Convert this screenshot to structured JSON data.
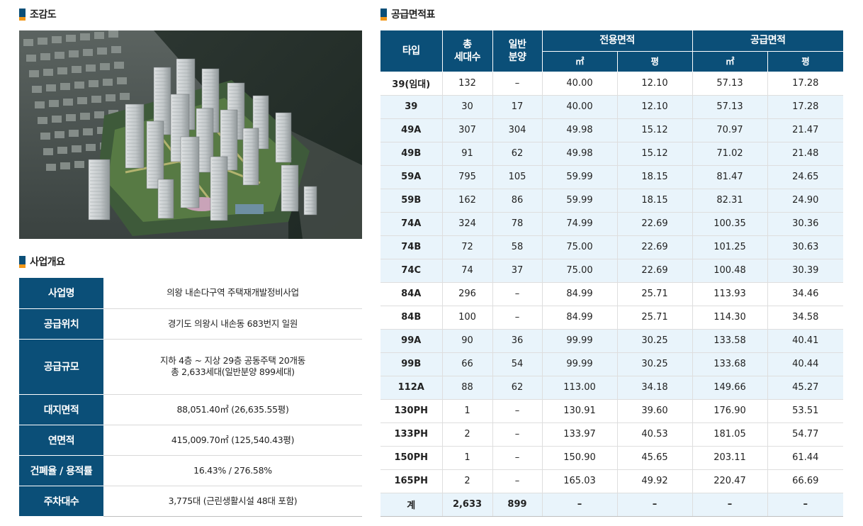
{
  "left": {
    "render_title": "조감도",
    "overview_title": "사업개요",
    "overview": [
      {
        "label": "사업명",
        "lines": [
          "의왕 내손다구역 주택재개발정비사업"
        ]
      },
      {
        "label": "공급위치",
        "lines": [
          "경기도 의왕시 내손동 683번지 일원"
        ]
      },
      {
        "label": "공급규모",
        "lines": [
          "지하 4층 ~ 지상 29층 공동주택 20개동",
          "총 2,633세대(일반분양 899세대)"
        ]
      },
      {
        "label": "대지면적",
        "lines": [
          "88,051.40㎡ (26,635.55평)"
        ]
      },
      {
        "label": "연면적",
        "lines": [
          "415,009.70㎡ (125,540.43평)"
        ]
      },
      {
        "label": "건폐율 / 용적률",
        "lines": [
          "16.43% / 276.58%"
        ]
      },
      {
        "label": "주차대수",
        "lines": [
          "3,775대 (근린생활시설 48대 포함)"
        ]
      }
    ]
  },
  "right": {
    "title": "공급면적표",
    "headers": {
      "type": "타입",
      "total_units": [
        "총",
        "세대수"
      ],
      "general_sale": [
        "일반",
        "분양"
      ],
      "exclusive_area": "전용면적",
      "supply_area": "공급면적",
      "sqm": "㎡",
      "pyeong": "평"
    },
    "rows": [
      [
        "39(임대)",
        "132",
        "–",
        "40.00",
        "12.10",
        "57.13",
        "17.28"
      ],
      [
        "39",
        "30",
        "17",
        "40.00",
        "12.10",
        "57.13",
        "17.28"
      ],
      [
        "49A",
        "307",
        "304",
        "49.98",
        "15.12",
        "70.97",
        "21.47"
      ],
      [
        "49B",
        "91",
        "62",
        "49.98",
        "15.12",
        "71.02",
        "21.48"
      ],
      [
        "59A",
        "795",
        "105",
        "59.99",
        "18.15",
        "81.47",
        "24.65"
      ],
      [
        "59B",
        "162",
        "86",
        "59.99",
        "18.15",
        "82.31",
        "24.90"
      ],
      [
        "74A",
        "324",
        "78",
        "74.99",
        "22.69",
        "100.35",
        "30.36"
      ],
      [
        "74B",
        "72",
        "58",
        "75.00",
        "22.69",
        "101.25",
        "30.63"
      ],
      [
        "74C",
        "74",
        "37",
        "75.00",
        "22.69",
        "100.48",
        "30.39"
      ],
      [
        "84A",
        "296",
        "–",
        "84.99",
        "25.71",
        "113.93",
        "34.46"
      ],
      [
        "84B",
        "100",
        "–",
        "84.99",
        "25.71",
        "114.30",
        "34.58"
      ],
      [
        "99A",
        "90",
        "36",
        "99.99",
        "30.25",
        "133.58",
        "40.41"
      ],
      [
        "99B",
        "66",
        "54",
        "99.99",
        "30.25",
        "133.68",
        "40.44"
      ],
      [
        "112A",
        "88",
        "62",
        "113.00",
        "34.18",
        "149.66",
        "45.27"
      ],
      [
        "130PH",
        "1",
        "–",
        "130.91",
        "39.60",
        "176.90",
        "53.51"
      ],
      [
        "133PH",
        "2",
        "–",
        "133.97",
        "40.53",
        "181.05",
        "54.77"
      ],
      [
        "150PH",
        "1",
        "–",
        "150.90",
        "45.65",
        "203.11",
        "61.44"
      ],
      [
        "165PH",
        "2",
        "–",
        "165.03",
        "49.92",
        "220.47",
        "66.69"
      ]
    ],
    "shaded_rows": [
      1,
      2,
      3,
      4,
      5,
      6,
      7,
      8,
      11,
      12,
      13
    ],
    "total": [
      "계",
      "2,633",
      "899",
      "–",
      "–",
      "–",
      "–"
    ]
  },
  "colors": {
    "header_navy": "#0b4f78",
    "accent_orange": "#f29718",
    "row_shade": "#e9f4fb"
  }
}
